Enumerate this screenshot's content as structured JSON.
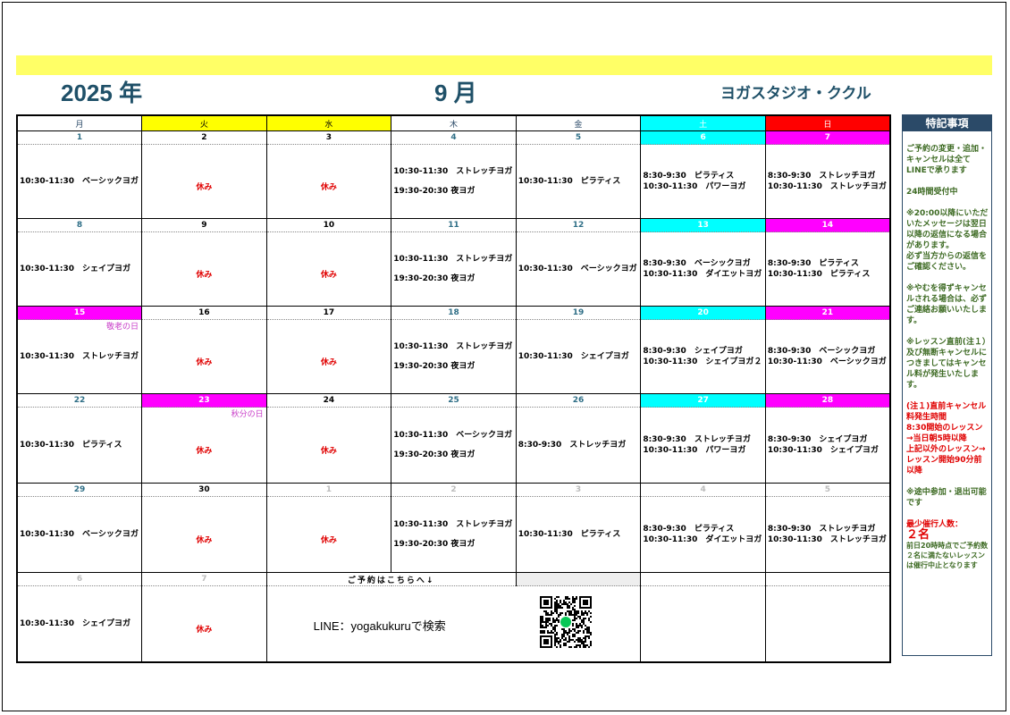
{
  "header": {
    "year": "2025 年",
    "month": "9 月",
    "studio": "ヨガスタジオ・ククル",
    "bar_color": "#ffff66"
  },
  "colors": {
    "tue": "#ffff00",
    "wed": "#ffff00",
    "sat": "#00ffff",
    "sun_header": "#ff0000",
    "sun_date": "#ff00ff",
    "holiday": "#ff00ff"
  },
  "weekdays": [
    "月",
    "火",
    "水",
    "木",
    "金",
    "土",
    "日"
  ],
  "weeks": [
    {
      "dates": [
        "1",
        "2",
        "3",
        "4",
        "5",
        "6",
        "7"
      ],
      "days": [
        {
          "lessons": [
            "10:30-11:30　ベーシックヨガ"
          ]
        },
        {
          "rest": "休み"
        },
        {
          "rest": "休み"
        },
        {
          "lessons": [
            "10:30-11:30　ストレッチヨガ"
          ],
          "night": "19:30-20:30 夜ヨガ"
        },
        {
          "lessons": [
            "10:30-11:30　ピラティス"
          ]
        },
        {
          "lessons": [
            "8:30-9:30　ピラティス",
            "10:30-11:30　パワーヨガ"
          ]
        },
        {
          "lessons": [
            "8:30-9:30　ストレッチヨガ",
            "10:30-11:30　ストレッチヨガ"
          ]
        }
      ]
    },
    {
      "dates": [
        "8",
        "9",
        "10",
        "11",
        "12",
        "13",
        "14"
      ],
      "days": [
        {
          "lessons": [
            "10:30-11:30　シェイプヨガ"
          ]
        },
        {
          "rest": "休み"
        },
        {
          "rest": "休み"
        },
        {
          "lessons": [
            "10:30-11:30　ストレッチヨガ"
          ],
          "night": "19:30-20:30 夜ヨガ"
        },
        {
          "lessons": [
            "10:30-11:30　ベーシックヨガ"
          ]
        },
        {
          "lessons": [
            "8:30-9:30　ベーシックヨガ",
            "10:30-11:30　ダイエットヨガ"
          ]
        },
        {
          "lessons": [
            "8:30-9:30　ピラティス",
            "10:30-11:30　ピラティス"
          ]
        }
      ]
    },
    {
      "dates": [
        "15",
        "16",
        "17",
        "18",
        "19",
        "20",
        "21"
      ],
      "days": [
        {
          "holiday": "敬老の日",
          "lessons": [
            "10:30-11:30　ストレッチヨガ"
          ]
        },
        {
          "rest": "休み"
        },
        {
          "rest": "休み"
        },
        {
          "lessons": [
            "10:30-11:30　ストレッチヨガ"
          ],
          "night": "19:30-20:30 夜ヨガ"
        },
        {
          "lessons": [
            "10:30-11:30　シェイプヨガ"
          ]
        },
        {
          "lessons": [
            "8:30-9:30　シェイプヨガ",
            "10:30-11:30　シェイプヨガ２"
          ]
        },
        {
          "lessons": [
            "8:30-9:30　ベーシックヨガ",
            "10:30-11:30　ベーシックヨガ"
          ]
        }
      ]
    },
    {
      "dates": [
        "22",
        "23",
        "24",
        "25",
        "26",
        "27",
        "28"
      ],
      "days": [
        {
          "lessons": [
            "10:30-11:30　ピラティス"
          ]
        },
        {
          "holiday": "秋分の日",
          "rest": "休み"
        },
        {
          "rest": "休み"
        },
        {
          "lessons": [
            "10:30-11:30　ベーシックヨガ"
          ],
          "night": "19:30-20:30 夜ヨガ"
        },
        {
          "lessons": [
            "8:30-9:30　ストレッチヨガ"
          ]
        },
        {
          "lessons": [
            "8:30-9:30　ストレッチヨガ",
            "10:30-11:30　パワーヨガ"
          ]
        },
        {
          "lessons": [
            "8:30-9:30　シェイプヨガ",
            "10:30-11:30　シェイプヨガ"
          ]
        }
      ]
    },
    {
      "dates": [
        "29",
        "30",
        "1",
        "2",
        "3",
        "4",
        "5"
      ],
      "days": [
        {
          "lessons": [
            "10:30-11:30　ベーシックヨガ"
          ]
        },
        {
          "rest": "休み"
        },
        {
          "rest": "休み"
        },
        {
          "lessons": [
            "10:30-11:30　ストレッチヨガ"
          ],
          "night": "19:30-20:30 夜ヨガ"
        },
        {
          "lessons": [
            "10:30-11:30　ピラティス"
          ]
        },
        {
          "lessons": [
            "8:30-9:30　ピラティス",
            "10:30-11:30　ダイエットヨガ"
          ]
        },
        {
          "lessons": [
            "8:30-9:30　ストレッチヨガ",
            "10:30-11:30　ストレッチヨガ"
          ]
        }
      ]
    }
  ],
  "last_week": {
    "dates": [
      "6",
      "7"
    ],
    "reserve_label": "ご予約はこちらへ↓",
    "mon_lesson": "10:30-11:30　シェイプヨガ",
    "tue_rest": "休み",
    "line_text": "LINE：yogakukuruで検索",
    "qr_icon": "qr-code-icon"
  },
  "sidebar": {
    "title": "特記事項",
    "notes": [
      "ご予約の変更・追加・キャンセルは全てLINEで承ります",
      "24時間受付中",
      "※20:00以降にいただいたメッセージは翌日以降の返信になる場合があります。\n必ず当方からの返信をご確認ください。",
      "※やむを得ずキャンセルされる場合は、必ずご連絡お願いいたします。",
      "※レッスン直前(注１）及び無断キャンセルにつきましてはキャンセル料が発生いたします。"
    ],
    "red_note": "(注１)直前キャンセル料発生時間\n8:30開始のレッスン→当日朝5時以降\n上記以外のレッスン→レッスン開始90分前以降",
    "note_midway": "※途中参加・退出可能です",
    "min_label": "最少催行人数：",
    "min_count": "２名",
    "min_note": "前日20時時点でご予約数２名に満たないレッスンは催行中止となります"
  }
}
